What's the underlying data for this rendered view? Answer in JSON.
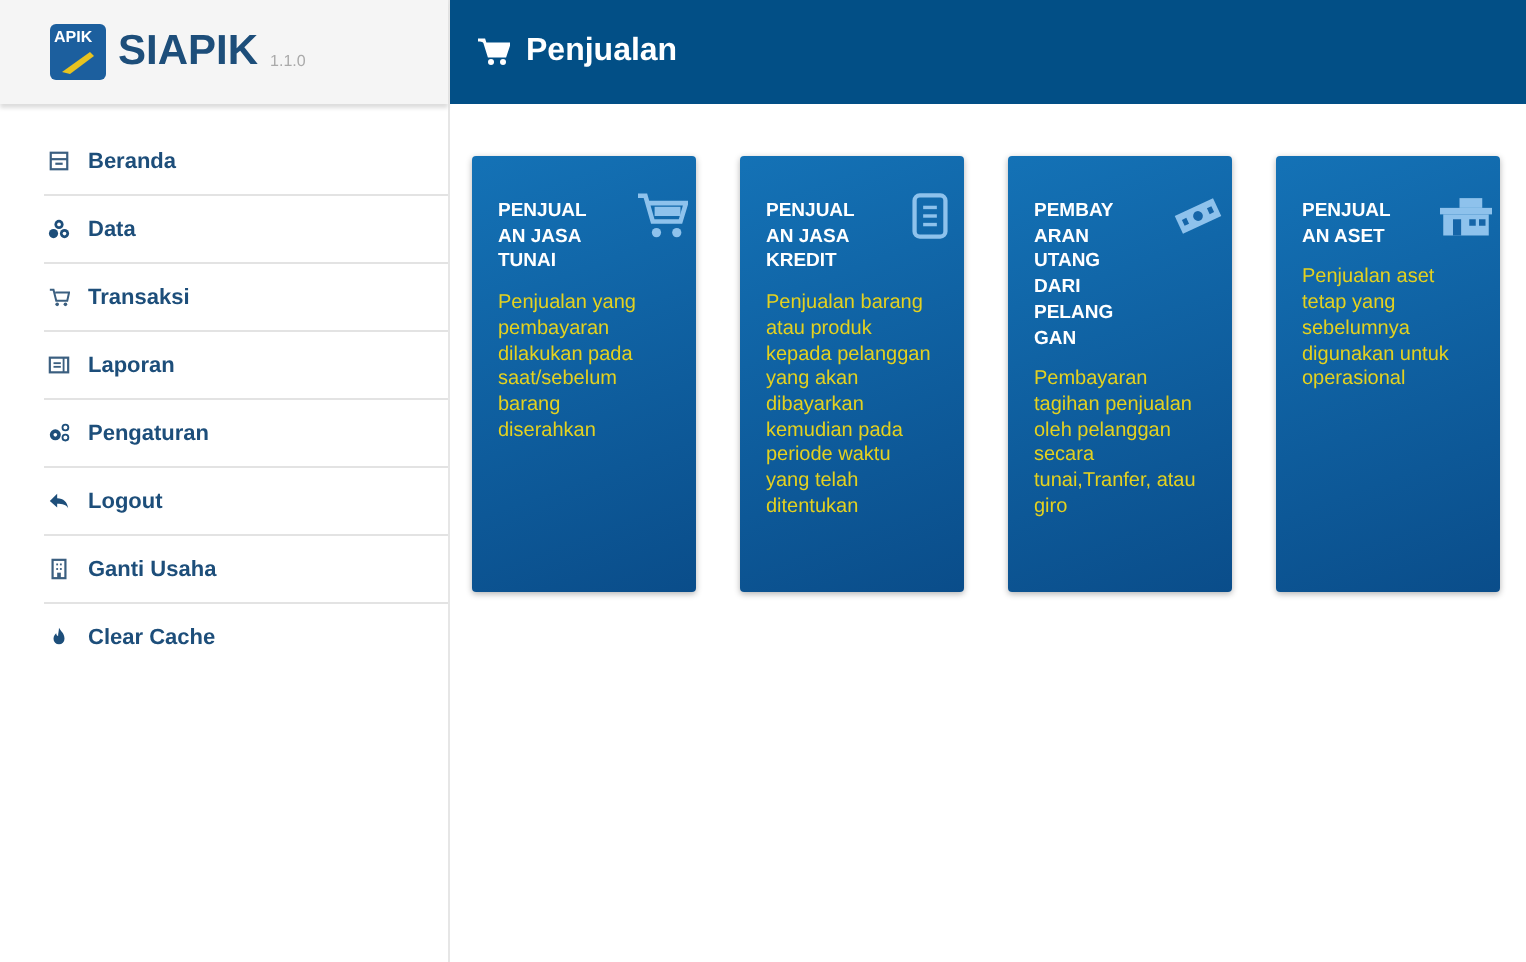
{
  "app": {
    "name": "SIAPIK",
    "version": "1.1.0",
    "logo_text": "APIK"
  },
  "header": {
    "title": "Penjualan"
  },
  "sidebar": {
    "items": [
      {
        "label": "Beranda",
        "kind": "store"
      },
      {
        "label": "Data",
        "kind": "cubes"
      },
      {
        "label": "Transaksi",
        "kind": "cart"
      },
      {
        "label": "Laporan",
        "kind": "report"
      },
      {
        "label": "Pengaturan",
        "kind": "gears"
      },
      {
        "label": "Logout",
        "kind": "reply"
      },
      {
        "label": "Ganti Usaha",
        "kind": "building"
      },
      {
        "label": "Clear Cache",
        "kind": "fire"
      }
    ]
  },
  "cards": [
    {
      "title_lines": [
        "PENJUAL",
        "AN JASA",
        "TUNAI"
      ],
      "description_lines": [
        "Penjualan yang",
        "pembayaran",
        "dilakukan pada",
        "saat/sebelum",
        "barang",
        "diserahkan"
      ],
      "kind": "cart"
    },
    {
      "title_lines": [
        "PENJUAL",
        "AN JASA",
        "KREDIT"
      ],
      "description_lines": [
        "Penjualan barang",
        "atau produk",
        "kepada pelanggan",
        "yang akan",
        "dibayarkan",
        "kemudian pada",
        "periode waktu",
        "yang telah",
        "ditentukan"
      ],
      "kind": "document"
    },
    {
      "title_lines": [
        "PEMBAY",
        "ARAN",
        "UTANG",
        "DARI",
        "PELANG",
        "GAN"
      ],
      "description_lines": [
        "Pembayaran",
        "tagihan penjualan",
        "oleh pelanggan",
        "secara",
        "tunai,Tranfer, atau",
        "giro"
      ],
      "kind": "money"
    },
    {
      "title_lines": [
        "PENJUAL",
        "AN ASET"
      ],
      "description_lines": [
        "Penjualan aset",
        "tetap yang",
        "sebelumnya",
        "digunakan untuk",
        "operasional"
      ],
      "kind": "building"
    }
  ]
}
